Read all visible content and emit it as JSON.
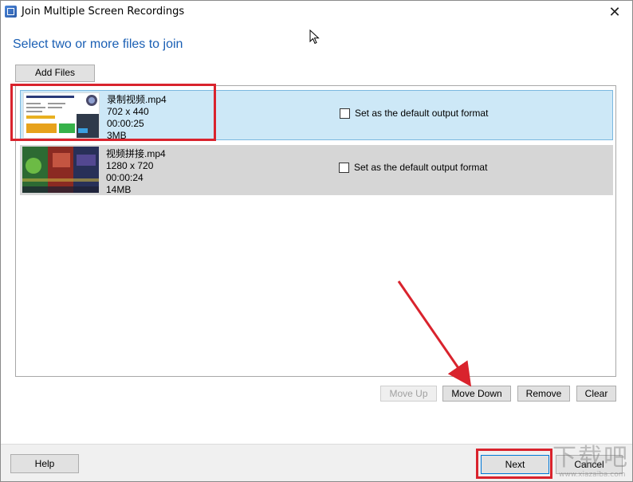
{
  "window": {
    "title": "Join Multiple Screen Recordings",
    "close_glyph": "✕",
    "icon": "app-icon"
  },
  "heading": "Select two or more files to join",
  "toolbar": {
    "add_files_label": "Add Files"
  },
  "files": [
    {
      "name": "录制视频.mp4",
      "resolution": "702 x 440",
      "duration": "00:00:25",
      "size": "3MB",
      "selected": true,
      "default_format_label": "Set as the default output format",
      "default_format_checked": false
    },
    {
      "name": "视频拼接.mp4",
      "resolution": "1280 x 720",
      "duration": "00:00:24",
      "size": "14MB",
      "selected": false,
      "default_format_label": "Set as the default output format",
      "default_format_checked": false
    }
  ],
  "list_actions": {
    "move_up_label": "Move Up",
    "move_down_label": "Move Down",
    "remove_label": "Remove",
    "clear_label": "Clear"
  },
  "footer": {
    "help_label": "Help",
    "next_label": "Next",
    "cancel_label": "Cancel"
  },
  "watermark": {
    "main": "下载吧",
    "sub": "www.xiazaiba.com"
  },
  "colors": {
    "heading": "#1a5fb4",
    "selected_row": "#cde8f7",
    "unselected_row": "#d6d6d6",
    "annotation": "#d9232d"
  }
}
